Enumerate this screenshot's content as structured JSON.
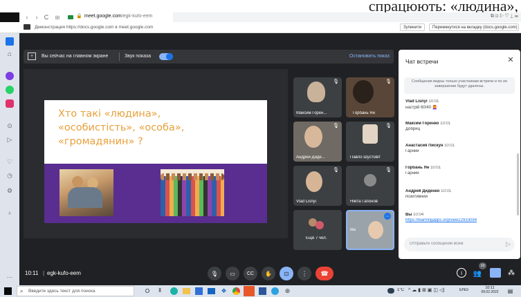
{
  "heading_fragment": "спрацюють: «людина»,",
  "browser": {
    "url_host": "meet.google.com",
    "url_path": "/egk-kufo-eem",
    "share_notice": "Демонстрация https://docs.google.com в meet.google.com",
    "stop_btn": "Зупинити",
    "switch_btn": "Перемкнутися на вкладку (docs.google.com)"
  },
  "banner": {
    "presenting_text": "Вы сейчас на главном экране",
    "sound_label": "Звук показа",
    "stop_label": "Остановить показ"
  },
  "slide": {
    "title": "Хто такі «людина»,\n«особистість», «особа»,\n«громадянин» ?"
  },
  "participants": [
    {
      "name": "Максим Горен..."
    },
    {
      "name": "Горбань Ян"
    },
    {
      "name": "Андрей Диде..."
    },
    {
      "name": "Павло Шустовіт"
    },
    {
      "name": "Vlad Lisnyi"
    },
    {
      "name": "Нікіта Гапонов"
    },
    {
      "name": "Ещё 7 чел."
    },
    {
      "name": "Вы"
    }
  ],
  "chat": {
    "title": "Чат встречи",
    "notice": "Сообщения видны только участникам встречи и по ее завершении будут удалены.",
    "messages": [
      {
        "author": "Vlad Lisnyi",
        "time": "10:01",
        "text": "настрій 60/40"
      },
      {
        "author": "Максим Горенко",
        "time": "10:01",
        "text": "Добриц"
      },
      {
        "author": "Анастасия Пискун",
        "time": "10:01",
        "text": "Гарний"
      },
      {
        "author": "Горбань Ян",
        "time": "10:01",
        "text": "Гарний"
      },
      {
        "author": "Андрей Диденко",
        "time": "10:01",
        "text": "позитивний"
      },
      {
        "author": "Вы",
        "time": "10:04",
        "text": "https://learningapps.org/view22933094"
      }
    ],
    "placeholder": "Отправьте сообщение всем"
  },
  "bottom": {
    "time": "10:11",
    "meeting_code": "egk-kufo-eem",
    "people_badge": "10"
  },
  "taskbar": {
    "search_placeholder": "Введите здесь текст для поиска",
    "weather": "1°C",
    "lang": "ENG",
    "clock_time": "10:11",
    "clock_date": "09.02.2022"
  },
  "colors": {
    "meet_bg": "#202124",
    "tile_bg": "#3c4043",
    "slide_title": "#e8a03a",
    "slide_band": "#5a2d91",
    "end_call": "#ea4335",
    "accent": "#8ab4f8",
    "chat_link": "#1a73e8"
  }
}
